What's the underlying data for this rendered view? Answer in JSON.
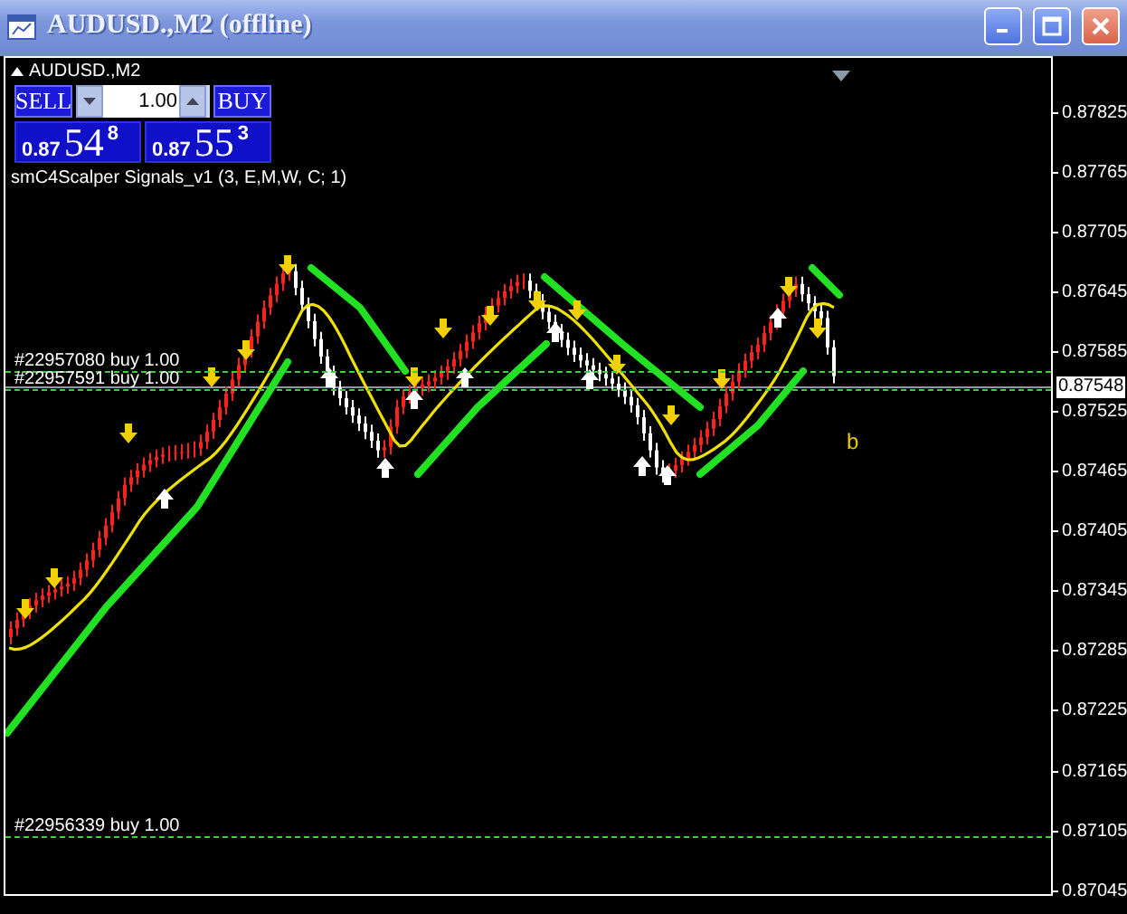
{
  "window": {
    "title": "AUDUSD.,M2 (offline)"
  },
  "chart": {
    "symbol": "AUDUSD.,M2",
    "indicator": "smC4Scalper Signals_v1 (3, E,M,W, C; 1)",
    "signal_mark": "b",
    "trade_panel": {
      "sell_label": "SELL",
      "buy_label": "BUY",
      "lot": "1.00",
      "bid": {
        "prefix": "0.87",
        "big": "54",
        "pip": "8"
      },
      "ask": {
        "prefix": "0.87",
        "big": "55",
        "pip": "3"
      }
    },
    "orders": [
      {
        "label": "#22957080 buy 1.00"
      },
      {
        "label": "#22957591 buy 1.00"
      },
      {
        "label": "#22956339 buy 1.00"
      }
    ],
    "price_axis": [
      "0.87825",
      "0.87765",
      "0.87705",
      "0.87645",
      "0.87585",
      "0.87525",
      "0.87465",
      "0.87405",
      "0.87345",
      "0.87285",
      "0.87225",
      "0.87165",
      "0.87105",
      "0.87045"
    ],
    "current_price": "0.87548"
  }
}
